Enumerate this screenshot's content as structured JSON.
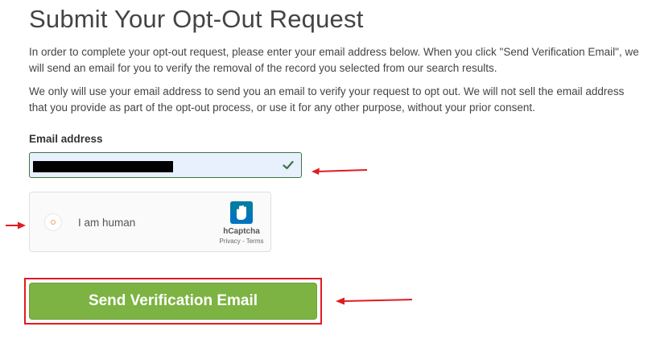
{
  "page": {
    "title": "Submit Your Opt-Out Request",
    "paragraph1": "In order to complete your opt-out request, please enter your email address below. When you click \"Send Verification Email\", we will send an email for you to verify the removal of the record you selected from our search results.",
    "paragraph2": "We only will use your email address to send you an email to verify your request to opt out. We will not sell the email address that you provide as part of the opt-out process, or use it for any other purpose, without your prior consent."
  },
  "form": {
    "email_label": "Email address",
    "email_value": "",
    "email_valid_icon": "checkmark-icon",
    "submit_label": "Send Verification Email"
  },
  "captcha": {
    "label": "I am human",
    "brand": "hCaptcha",
    "links": "Privacy - Terms",
    "logo_icon": "hcaptcha-hand-icon"
  },
  "annotations": {
    "arrow_color": "#e01b22",
    "outline_color": "#e01b22"
  },
  "colors": {
    "submit_button": "#7cb342",
    "field_valid_border": "#3c763d",
    "field_background": "#e8f0fe"
  }
}
